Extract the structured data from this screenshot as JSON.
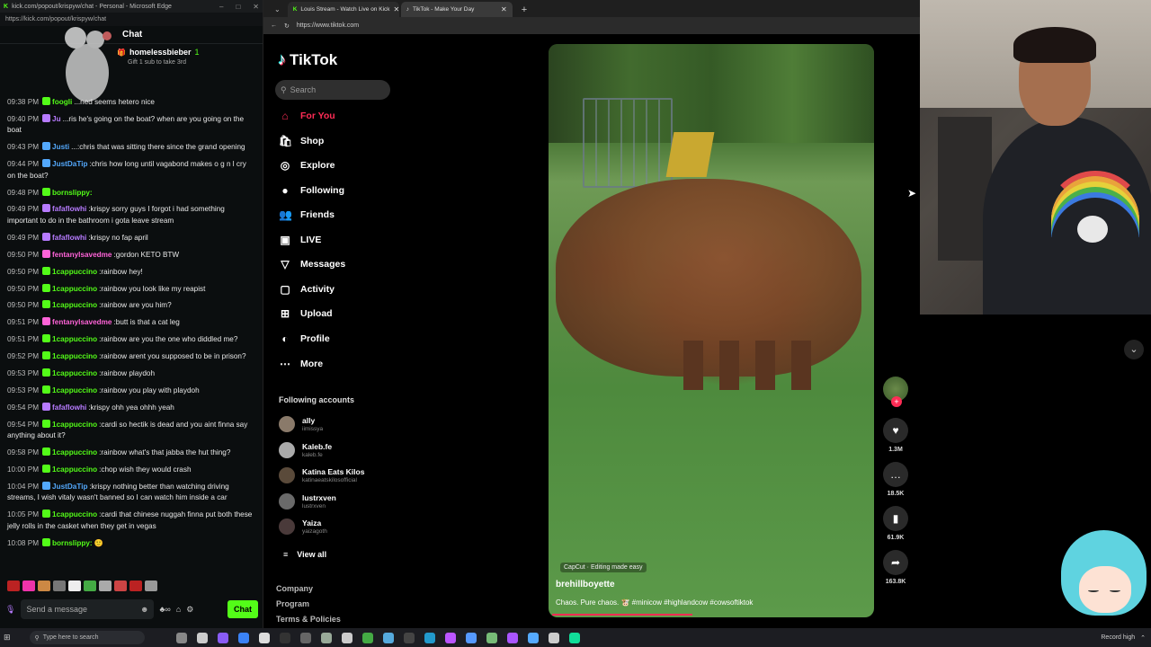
{
  "chat_window": {
    "title": "kick.com/popout/krispyw/chat - Personal - Microsoft Edge",
    "url": "https://kick.com/popout/krispyw/chat",
    "header": "Chat",
    "pinned": {
      "user": "homelessbieber",
      "count": "1",
      "text": "Gift 1 sub to take 3rd"
    },
    "messages": [
      {
        "time": "09:38 PM",
        "user": "foogli",
        "color": "#53fc18",
        "text": "...ned seems hetero nice"
      },
      {
        "time": "09:40 PM",
        "user": "Ju",
        "color": "#b77bff",
        "text": "...ris he's going on the boat? when are you going on the boat"
      },
      {
        "time": "09:43 PM",
        "user": "Justi",
        "color": "#53a8fc",
        "text": "...:chris that was sitting there since the grand opening"
      },
      {
        "time": "09:44 PM",
        "user": "JustDaTip",
        "color": "#53a8fc",
        "text": ":chris how long until vagabond makes o g n l cry on the boat?"
      },
      {
        "time": "09:48 PM",
        "user": "bornslippy:",
        "color": "#53fc18",
        "text": ""
      },
      {
        "time": "09:49 PM",
        "user": "fafaflowhi",
        "color": "#b77bff",
        "text": ":krispy sorry guys I forgot i had something important to do in the bathroom i gota leave stream"
      },
      {
        "time": "09:49 PM",
        "user": "fafaflowhi",
        "color": "#b77bff",
        "text": ":krispy no fap april"
      },
      {
        "time": "09:50 PM",
        "user": "fentanylsavedme",
        "color": "#ff63d8",
        "text": ":gordon KETO BTW"
      },
      {
        "time": "09:50 PM",
        "user": "1cappuccino",
        "color": "#53fc18",
        "text": ":rainbow hey!"
      },
      {
        "time": "09:50 PM",
        "user": "1cappuccino",
        "color": "#53fc18",
        "text": ":rainbow you look like my reapist"
      },
      {
        "time": "09:50 PM",
        "user": "1cappuccino",
        "color": "#53fc18",
        "text": ":rainbow are you him?"
      },
      {
        "time": "09:51 PM",
        "user": "fentanylsavedme",
        "color": "#ff63d8",
        "text": ":butt is that a cat leg"
      },
      {
        "time": "09:51 PM",
        "user": "1cappuccino",
        "color": "#53fc18",
        "text": ":rainbow are you the one who diddled me?"
      },
      {
        "time": "09:52 PM",
        "user": "1cappuccino",
        "color": "#53fc18",
        "text": ":rainbow arent you supposed to be in prison?"
      },
      {
        "time": "09:53 PM",
        "user": "1cappuccino",
        "color": "#53fc18",
        "text": ":rainbow playdoh"
      },
      {
        "time": "09:53 PM",
        "user": "1cappuccino",
        "color": "#53fc18",
        "text": ":rainbow you play with playdoh"
      },
      {
        "time": "09:54 PM",
        "user": "fafaflowhi",
        "color": "#b77bff",
        "text": ":krispy ohh yea ohhh yeah"
      },
      {
        "time": "09:54 PM",
        "user": "1cappuccino",
        "color": "#53fc18",
        "text": ":cardi so hectik is dead and you aint finna say anything about it?"
      },
      {
        "time": "09:58 PM",
        "user": "1cappuccino",
        "color": "#53fc18",
        "text": ":rainbow what's that jabba the hut thing?"
      },
      {
        "time": "10:00 PM",
        "user": "1cappuccino",
        "color": "#53fc18",
        "text": ":chop wish they would crash"
      },
      {
        "time": "10:04 PM",
        "user": "JustDaTip",
        "color": "#53a8fc",
        "text": ":krispy nothing better than watching driving streams, I wish vitaly wasn't banned so I can watch him inside a car"
      },
      {
        "time": "10:05 PM",
        "user": "1cappuccino",
        "color": "#53fc18",
        "text": ":cardi that chinese nuggah finna put both these jelly rolls in the casket when they get in vegas"
      },
      {
        "time": "10:08 PM",
        "user": "bornslippy:",
        "color": "#53fc18",
        "text": "🙂"
      }
    ],
    "input_placeholder": "Send a message",
    "send_label": "Chat"
  },
  "browser": {
    "tabs": [
      {
        "label": "Louis Stream - Watch Live on Kick"
      },
      {
        "label": "TikTok - Make Your Day"
      }
    ],
    "url": "https://www.tiktok.com"
  },
  "tiktok": {
    "logo": "TikTok",
    "search_placeholder": "Search",
    "nav": [
      {
        "label": "For You",
        "icon": "home-icon",
        "glyph": "⌂"
      },
      {
        "label": "Shop",
        "icon": "shop-icon",
        "glyph": "🛍"
      },
      {
        "label": "Explore",
        "icon": "explore-icon",
        "glyph": "◎"
      },
      {
        "label": "Following",
        "icon": "following-icon",
        "glyph": "●"
      },
      {
        "label": "Friends",
        "icon": "friends-icon",
        "glyph": "👥"
      },
      {
        "label": "LIVE",
        "icon": "live-icon",
        "glyph": "▣"
      },
      {
        "label": "Messages",
        "icon": "messages-icon",
        "glyph": "▽"
      },
      {
        "label": "Activity",
        "icon": "activity-icon",
        "glyph": "▢"
      },
      {
        "label": "Upload",
        "icon": "upload-icon",
        "glyph": "⊞"
      },
      {
        "label": "Profile",
        "icon": "profile-icon",
        "glyph": "◐"
      },
      {
        "label": "More",
        "icon": "more-icon",
        "glyph": "⋯"
      }
    ],
    "following_title": "Following accounts",
    "accounts": [
      {
        "name": "ally",
        "handle": "iimissya"
      },
      {
        "name": "Kaleb.fe",
        "handle": "kaleb.fe"
      },
      {
        "name": "Katina Eats Kilos",
        "handle": "katinaeatskilosofficial"
      },
      {
        "name": "lustrxven",
        "handle": "lustrxven"
      },
      {
        "name": "Yaiza",
        "handle": "yaizagoth"
      }
    ],
    "view_all": "View all",
    "footer": [
      "Company",
      "Program",
      "Terms & Policies"
    ],
    "video": {
      "capcut": "CapCut · Editing made easy",
      "author": "brehillboyette",
      "description": "Chaos. Pure chaos. 🐮 #minicow #highlandcow #cowsoftiktok",
      "progress_fraction": 0.43
    },
    "actions": [
      {
        "icon": "heart-icon",
        "glyph": "♥",
        "count": "1.3M"
      },
      {
        "icon": "comment-icon",
        "glyph": "…",
        "count": "18.5K"
      },
      {
        "icon": "bookmark-icon",
        "glyph": "▮",
        "count": "61.9K"
      },
      {
        "icon": "share-icon",
        "glyph": "➦",
        "count": "163.8K"
      }
    ]
  },
  "taskbar": {
    "search_placeholder": "Type here to search",
    "record": "Record high"
  },
  "colors": {
    "tiktok_accent": "#fe2c55",
    "kick_green": "#53fc18"
  }
}
